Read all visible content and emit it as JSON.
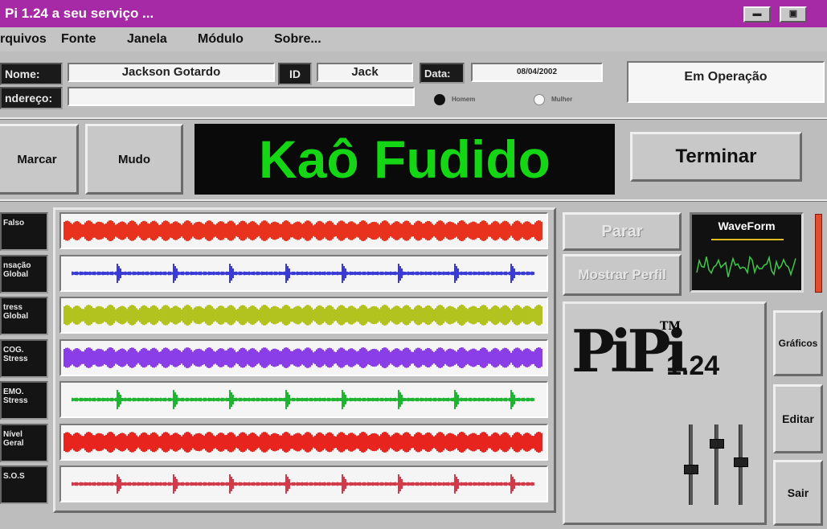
{
  "window": {
    "title": "Pi 1.24 a seu serviço ...",
    "min_label": "▬",
    "max_label": "▣"
  },
  "menu": [
    "rquivos",
    "Fonte",
    "Janela",
    "Módulo",
    "Sobre..."
  ],
  "info": {
    "name_label": "Nome:",
    "name_value": "Jackson Gotardo",
    "id_label": "ID",
    "id_value": "Jack",
    "data_label": "Data:",
    "data_value": "08/04/2002",
    "address_label": "ndereço:",
    "address_value": "",
    "radio_1_label": "Homem",
    "radio_2_label": "Mulher",
    "status": "Em Operação"
  },
  "buttons": {
    "marcar": "Marcar",
    "mudo": "Mudo",
    "terminar": "Terminar",
    "parar": "Parar",
    "mostrar_perfil": "Mostrar Perfil",
    "graficos": "Gráficos",
    "editar": "Editar",
    "sair": "Sair"
  },
  "display": {
    "text": "Kaô Fudido",
    "text_color": "#15d615",
    "background": "#0a0a0a"
  },
  "tracks": [
    {
      "label": "Falso",
      "color": "#e8321e",
      "style": "dense"
    },
    {
      "label": "nsação Global",
      "color": "#3a3ad6",
      "style": "sparse"
    },
    {
      "label": "tress Global",
      "color": "#b2c21e",
      "style": "dense"
    },
    {
      "label": "COG. Stress",
      "color": "#8a3ee8",
      "style": "dense"
    },
    {
      "label": "EMO. Stress",
      "color": "#1eb432",
      "style": "sparse"
    },
    {
      "label": "Nível Geral",
      "color": "#e8241e",
      "style": "dense"
    },
    {
      "label": "S.O.S",
      "color": "#d23a4a",
      "style": "sparse"
    }
  ],
  "waveform": {
    "title": "WaveForm",
    "line_color": "#3ec84a",
    "underline_color": "#e0c020"
  },
  "logo": {
    "text": "PiPi",
    "trademark": "TM",
    "version": "1.24"
  },
  "sliders": [
    0.55,
    0.2,
    0.45
  ],
  "colors": {
    "titlebar": "#a62aa6",
    "face": "#c0c0c0"
  }
}
